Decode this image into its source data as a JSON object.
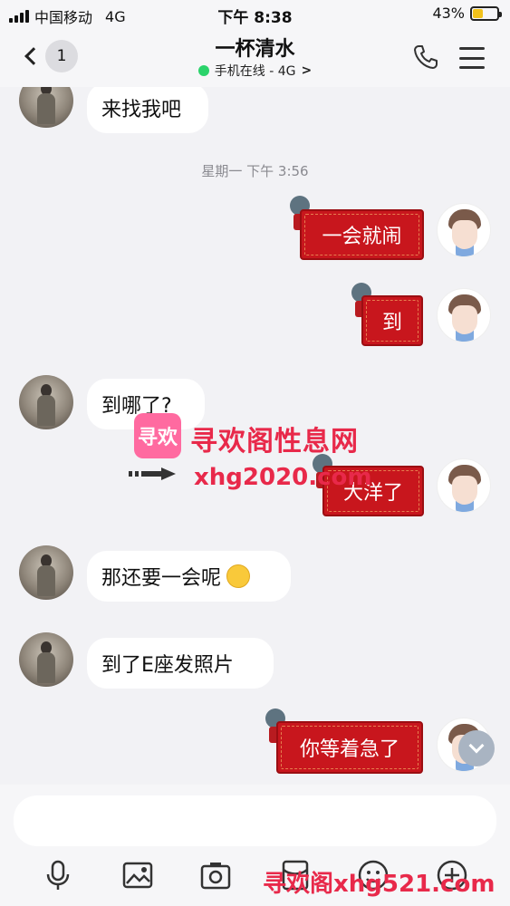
{
  "status_bar": {
    "carrier": "中国移动",
    "network": "4G",
    "time": "下午 8:38",
    "battery_percent": "43%",
    "battery_level": 0.43
  },
  "header": {
    "back_badge": "1",
    "title": "一杯清水",
    "online_status": "手机在线 - 4G",
    "online_chevron": ">"
  },
  "messages": [
    {
      "side": "in",
      "text": "来找我吧"
    },
    {
      "type": "timestamp",
      "text": "星期一 下午 3:56"
    },
    {
      "side": "out",
      "text": "一会就闹"
    },
    {
      "side": "out",
      "text": "到"
    },
    {
      "side": "in",
      "text": "到哪了?"
    },
    {
      "side": "out",
      "text": "大洋了"
    },
    {
      "side": "in",
      "text": "那还要一会呢",
      "emoji": "thinking-face"
    },
    {
      "side": "in",
      "text": "到了E座发照片"
    },
    {
      "side": "out",
      "text": "你等着急了"
    }
  ],
  "watermark": {
    "logo": "寻欢",
    "title": "寻欢阁性息网",
    "url": "xhg2020.com"
  },
  "bottom_watermark": "寻欢阁xhg521.com",
  "input": {
    "placeholder": ""
  },
  "toolbar": [
    "microphone-icon",
    "image-icon",
    "camera-icon",
    "red-packet-icon",
    "emoji-icon",
    "more-icon"
  ],
  "colors": {
    "red_bubble": "#c8161d",
    "online_dot": "#2bd36b",
    "watermark": "#e8294a"
  }
}
